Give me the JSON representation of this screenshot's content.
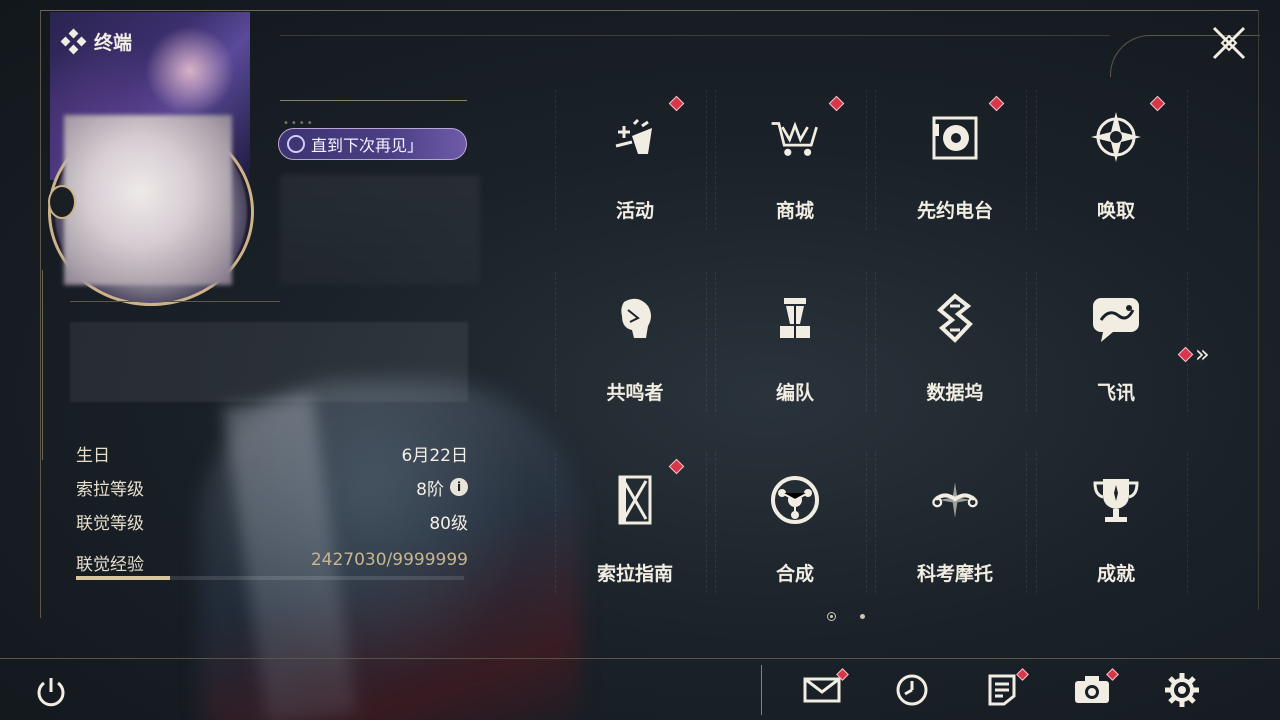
{
  "header": {
    "title": "终端"
  },
  "profile": {
    "signature": "直到下次再见」",
    "rows": [
      {
        "label": "生日",
        "value": "6月22日"
      },
      {
        "label": "索拉等级",
        "value": "8阶"
      },
      {
        "label": "联觉等级",
        "value": "80级"
      }
    ],
    "exp": {
      "label": "联觉经验",
      "value": "2427030/9999999",
      "fraction": 0.2427
    }
  },
  "menu": [
    {
      "label": "活动",
      "icon": "activity-icon",
      "badge": true
    },
    {
      "label": "商城",
      "icon": "shop-cart-icon",
      "badge": true
    },
    {
      "label": "先约电台",
      "icon": "radio-record-icon",
      "badge": true
    },
    {
      "label": "唤取",
      "icon": "compass-star-icon",
      "badge": true
    },
    {
      "label": "共鸣者",
      "icon": "resonator-head-icon",
      "badge": false
    },
    {
      "label": "编队",
      "icon": "chess-team-icon",
      "badge": false
    },
    {
      "label": "数据坞",
      "icon": "data-dock-icon",
      "badge": false
    },
    {
      "label": "飞讯",
      "icon": "chat-message-icon",
      "badge": false
    },
    {
      "label": "索拉指南",
      "icon": "guide-book-icon",
      "badge": true
    },
    {
      "label": "合成",
      "icon": "synthesis-icon",
      "badge": false
    },
    {
      "label": "科考摩托",
      "icon": "motorbike-icon",
      "badge": false
    },
    {
      "label": "成就",
      "icon": "trophy-icon",
      "badge": false
    }
  ],
  "pager": {
    "current": 1,
    "total": 2
  },
  "colors": {
    "badge": "#d8364a",
    "accent": "#d8c59d",
    "text": "#f2ede2"
  },
  "bottom_tools": [
    {
      "icon": "mail-icon",
      "badge": true
    },
    {
      "icon": "clock-icon",
      "badge": false
    },
    {
      "icon": "notes-icon",
      "badge": true
    },
    {
      "icon": "camera-icon",
      "badge": true
    },
    {
      "icon": "settings-gear-icon",
      "badge": false
    }
  ]
}
